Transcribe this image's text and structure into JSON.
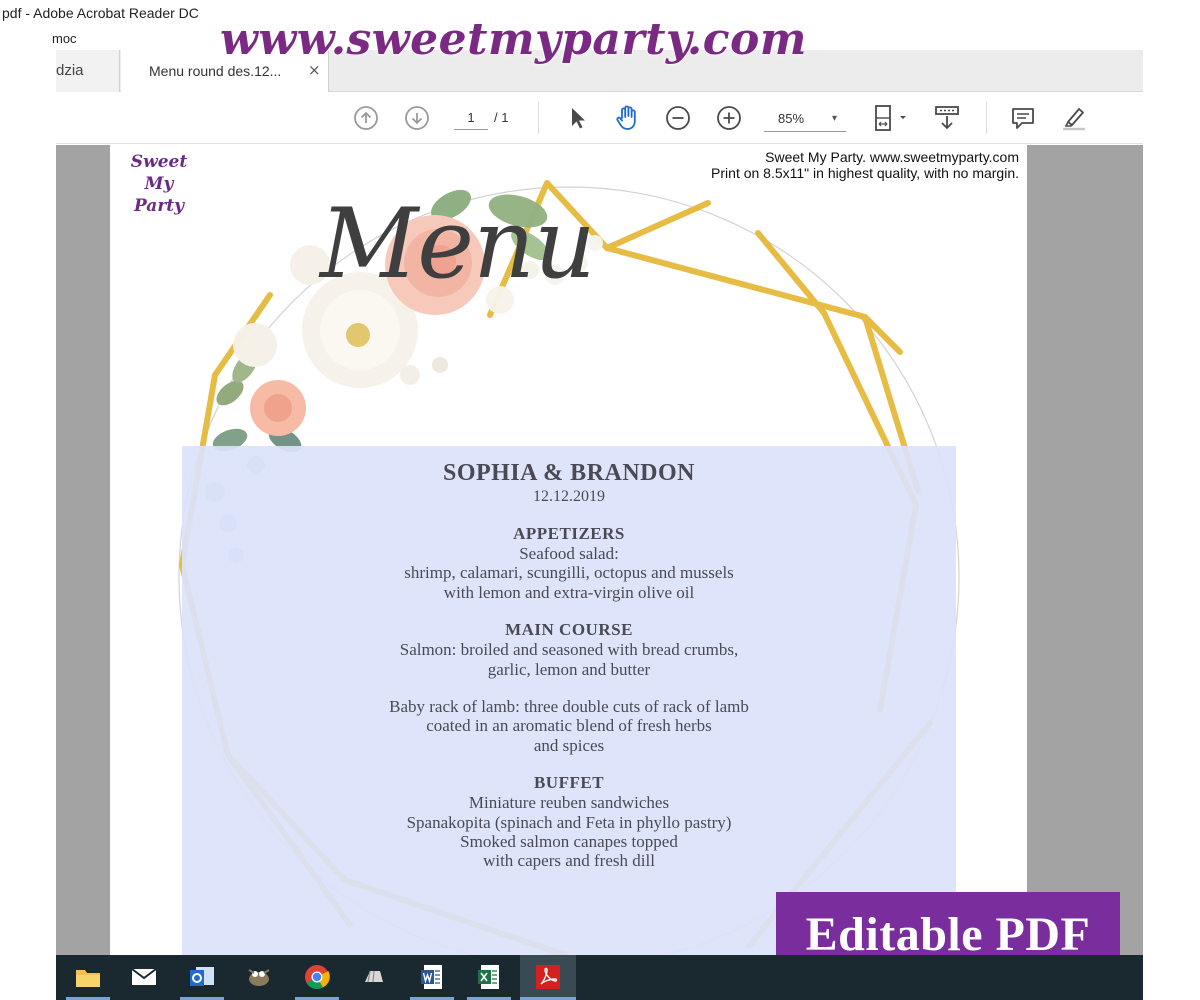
{
  "window": {
    "title": "pdf - Adobe Acrobat Reader DC",
    "menu_item": "moc"
  },
  "tabs": {
    "home_label": "dzia",
    "active_label": "Menu round des.12...",
    "close_glyph": "×"
  },
  "toolbar": {
    "page_current": "1",
    "page_total": "/ 1",
    "zoom": "85%",
    "zoom_arrow": "▾",
    "icons": [
      "prev-page-icon",
      "next-page-icon",
      "select-arrow-icon",
      "hand-icon",
      "zoom-out-icon",
      "zoom-in-icon",
      "fit-page-icon",
      "scroll-mode-icon",
      "comment-icon",
      "highlight-icon"
    ]
  },
  "document": {
    "header_note_1": "Sweet My Party.  www.sweetmyparty.com",
    "header_note_2": "Print on 8.5x11\" in highest quality, with no margin.",
    "logo_lines": [
      "Sweet",
      "My",
      "Party"
    ],
    "menu_word": "Menu",
    "names": "SOPHIA & BRANDON",
    "date": "12.12.2019",
    "sections": [
      {
        "title": "APPETIZERS",
        "lines": [
          "Seafood salad:",
          "shrimp, calamari, scungilli, octopus and mussels",
          "with lemon and extra-virgin olive oil"
        ]
      },
      {
        "title": "MAIN COURSE",
        "lines": [
          "Salmon: broiled and seasoned with bread crumbs,",
          "garlic, lemon  and butter"
        ],
        "lines_b": [
          "Baby rack of lamb: three double cuts of rack of lamb",
          "coated in an aromatic blend of fresh herbs",
          "and spices"
        ]
      },
      {
        "title": "BUFFET",
        "lines": [
          "Miniature reuben sandwiches",
          "Spanakopita (spinach and Feta in phyllo pastry)",
          "Smoked salmon canapes topped",
          "with capers and fresh dill"
        ]
      }
    ]
  },
  "overlay": {
    "watermark": "www.sweetmyparty.com",
    "badge": "Editable PDF"
  },
  "colors": {
    "brand_purple": "#7a2d9c",
    "panel_blue": "#dbe3fb",
    "gold": "#e5b93a",
    "viewer_gray": "#a3a3a3",
    "taskbar": "#1a2830"
  }
}
